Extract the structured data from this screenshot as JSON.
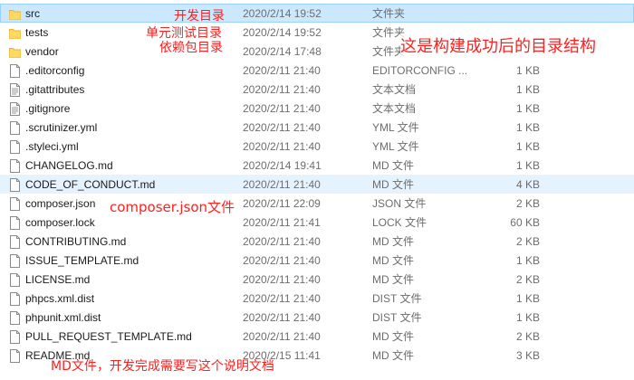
{
  "files": [
    {
      "name": "src",
      "date": "2020/2/14 19:52",
      "type": "文件夹",
      "size": "",
      "kind": "folder",
      "state": "selected"
    },
    {
      "name": "tests",
      "date": "2020/2/14 19:52",
      "type": "文件夹",
      "size": "",
      "kind": "folder",
      "state": ""
    },
    {
      "name": "vendor",
      "date": "2020/2/14 17:48",
      "type": "文件夹",
      "size": "",
      "kind": "folder",
      "state": ""
    },
    {
      "name": ".editorconfig",
      "date": "2020/2/11 21:40",
      "type": "EDITORCONFIG ...",
      "size": "1 KB",
      "kind": "file",
      "state": ""
    },
    {
      "name": ".gitattributes",
      "date": "2020/2/11 21:40",
      "type": "文本文档",
      "size": "1 KB",
      "kind": "text",
      "state": ""
    },
    {
      "name": ".gitignore",
      "date": "2020/2/11 21:40",
      "type": "文本文档",
      "size": "1 KB",
      "kind": "text",
      "state": ""
    },
    {
      "name": ".scrutinizer.yml",
      "date": "2020/2/11 21:40",
      "type": "YML 文件",
      "size": "1 KB",
      "kind": "file",
      "state": ""
    },
    {
      "name": ".styleci.yml",
      "date": "2020/2/11 21:40",
      "type": "YML 文件",
      "size": "1 KB",
      "kind": "file",
      "state": ""
    },
    {
      "name": "CHANGELOG.md",
      "date": "2020/2/14 19:41",
      "type": "MD 文件",
      "size": "1 KB",
      "kind": "file",
      "state": ""
    },
    {
      "name": "CODE_OF_CONDUCT.md",
      "date": "2020/2/11 21:40",
      "type": "MD 文件",
      "size": "4 KB",
      "kind": "file",
      "state": "hover"
    },
    {
      "name": "composer.json",
      "date": "2020/2/11 22:09",
      "type": "JSON 文件",
      "size": "2 KB",
      "kind": "file",
      "state": ""
    },
    {
      "name": "composer.lock",
      "date": "2020/2/11 21:41",
      "type": "LOCK 文件",
      "size": "60 KB",
      "kind": "file",
      "state": ""
    },
    {
      "name": "CONTRIBUTING.md",
      "date": "2020/2/11 21:40",
      "type": "MD 文件",
      "size": "2 KB",
      "kind": "file",
      "state": ""
    },
    {
      "name": "ISSUE_TEMPLATE.md",
      "date": "2020/2/11 21:40",
      "type": "MD 文件",
      "size": "1 KB",
      "kind": "file",
      "state": ""
    },
    {
      "name": "LICENSE.md",
      "date": "2020/2/11 21:40",
      "type": "MD 文件",
      "size": "2 KB",
      "kind": "file",
      "state": ""
    },
    {
      "name": "phpcs.xml.dist",
      "date": "2020/2/11 21:40",
      "type": "DIST 文件",
      "size": "1 KB",
      "kind": "file",
      "state": ""
    },
    {
      "name": "phpunit.xml.dist",
      "date": "2020/2/11 21:40",
      "type": "DIST 文件",
      "size": "1 KB",
      "kind": "file",
      "state": ""
    },
    {
      "name": "PULL_REQUEST_TEMPLATE.md",
      "date": "2020/2/11 21:40",
      "type": "MD 文件",
      "size": "2 KB",
      "kind": "file",
      "state": ""
    },
    {
      "name": "README.md",
      "date": "2020/2/15 11:41",
      "type": "MD 文件",
      "size": "3 KB",
      "kind": "file",
      "state": ""
    }
  ],
  "annotations": {
    "dev_dir": "开发目录",
    "test_dir": "单元测试目录",
    "dep_dir": "依赖包目录",
    "structure": "这是构建成功后的目录结构",
    "composer_json": "composer.json文件",
    "md_file": "MD文件，开发完成需要写这个说明文档"
  },
  "colors": {
    "annotation": "#ff2020",
    "folder": "#ffd862",
    "folder_dark": "#e8b339",
    "selected_bg": "#cce8ff",
    "hover_bg": "#e5f3ff"
  }
}
